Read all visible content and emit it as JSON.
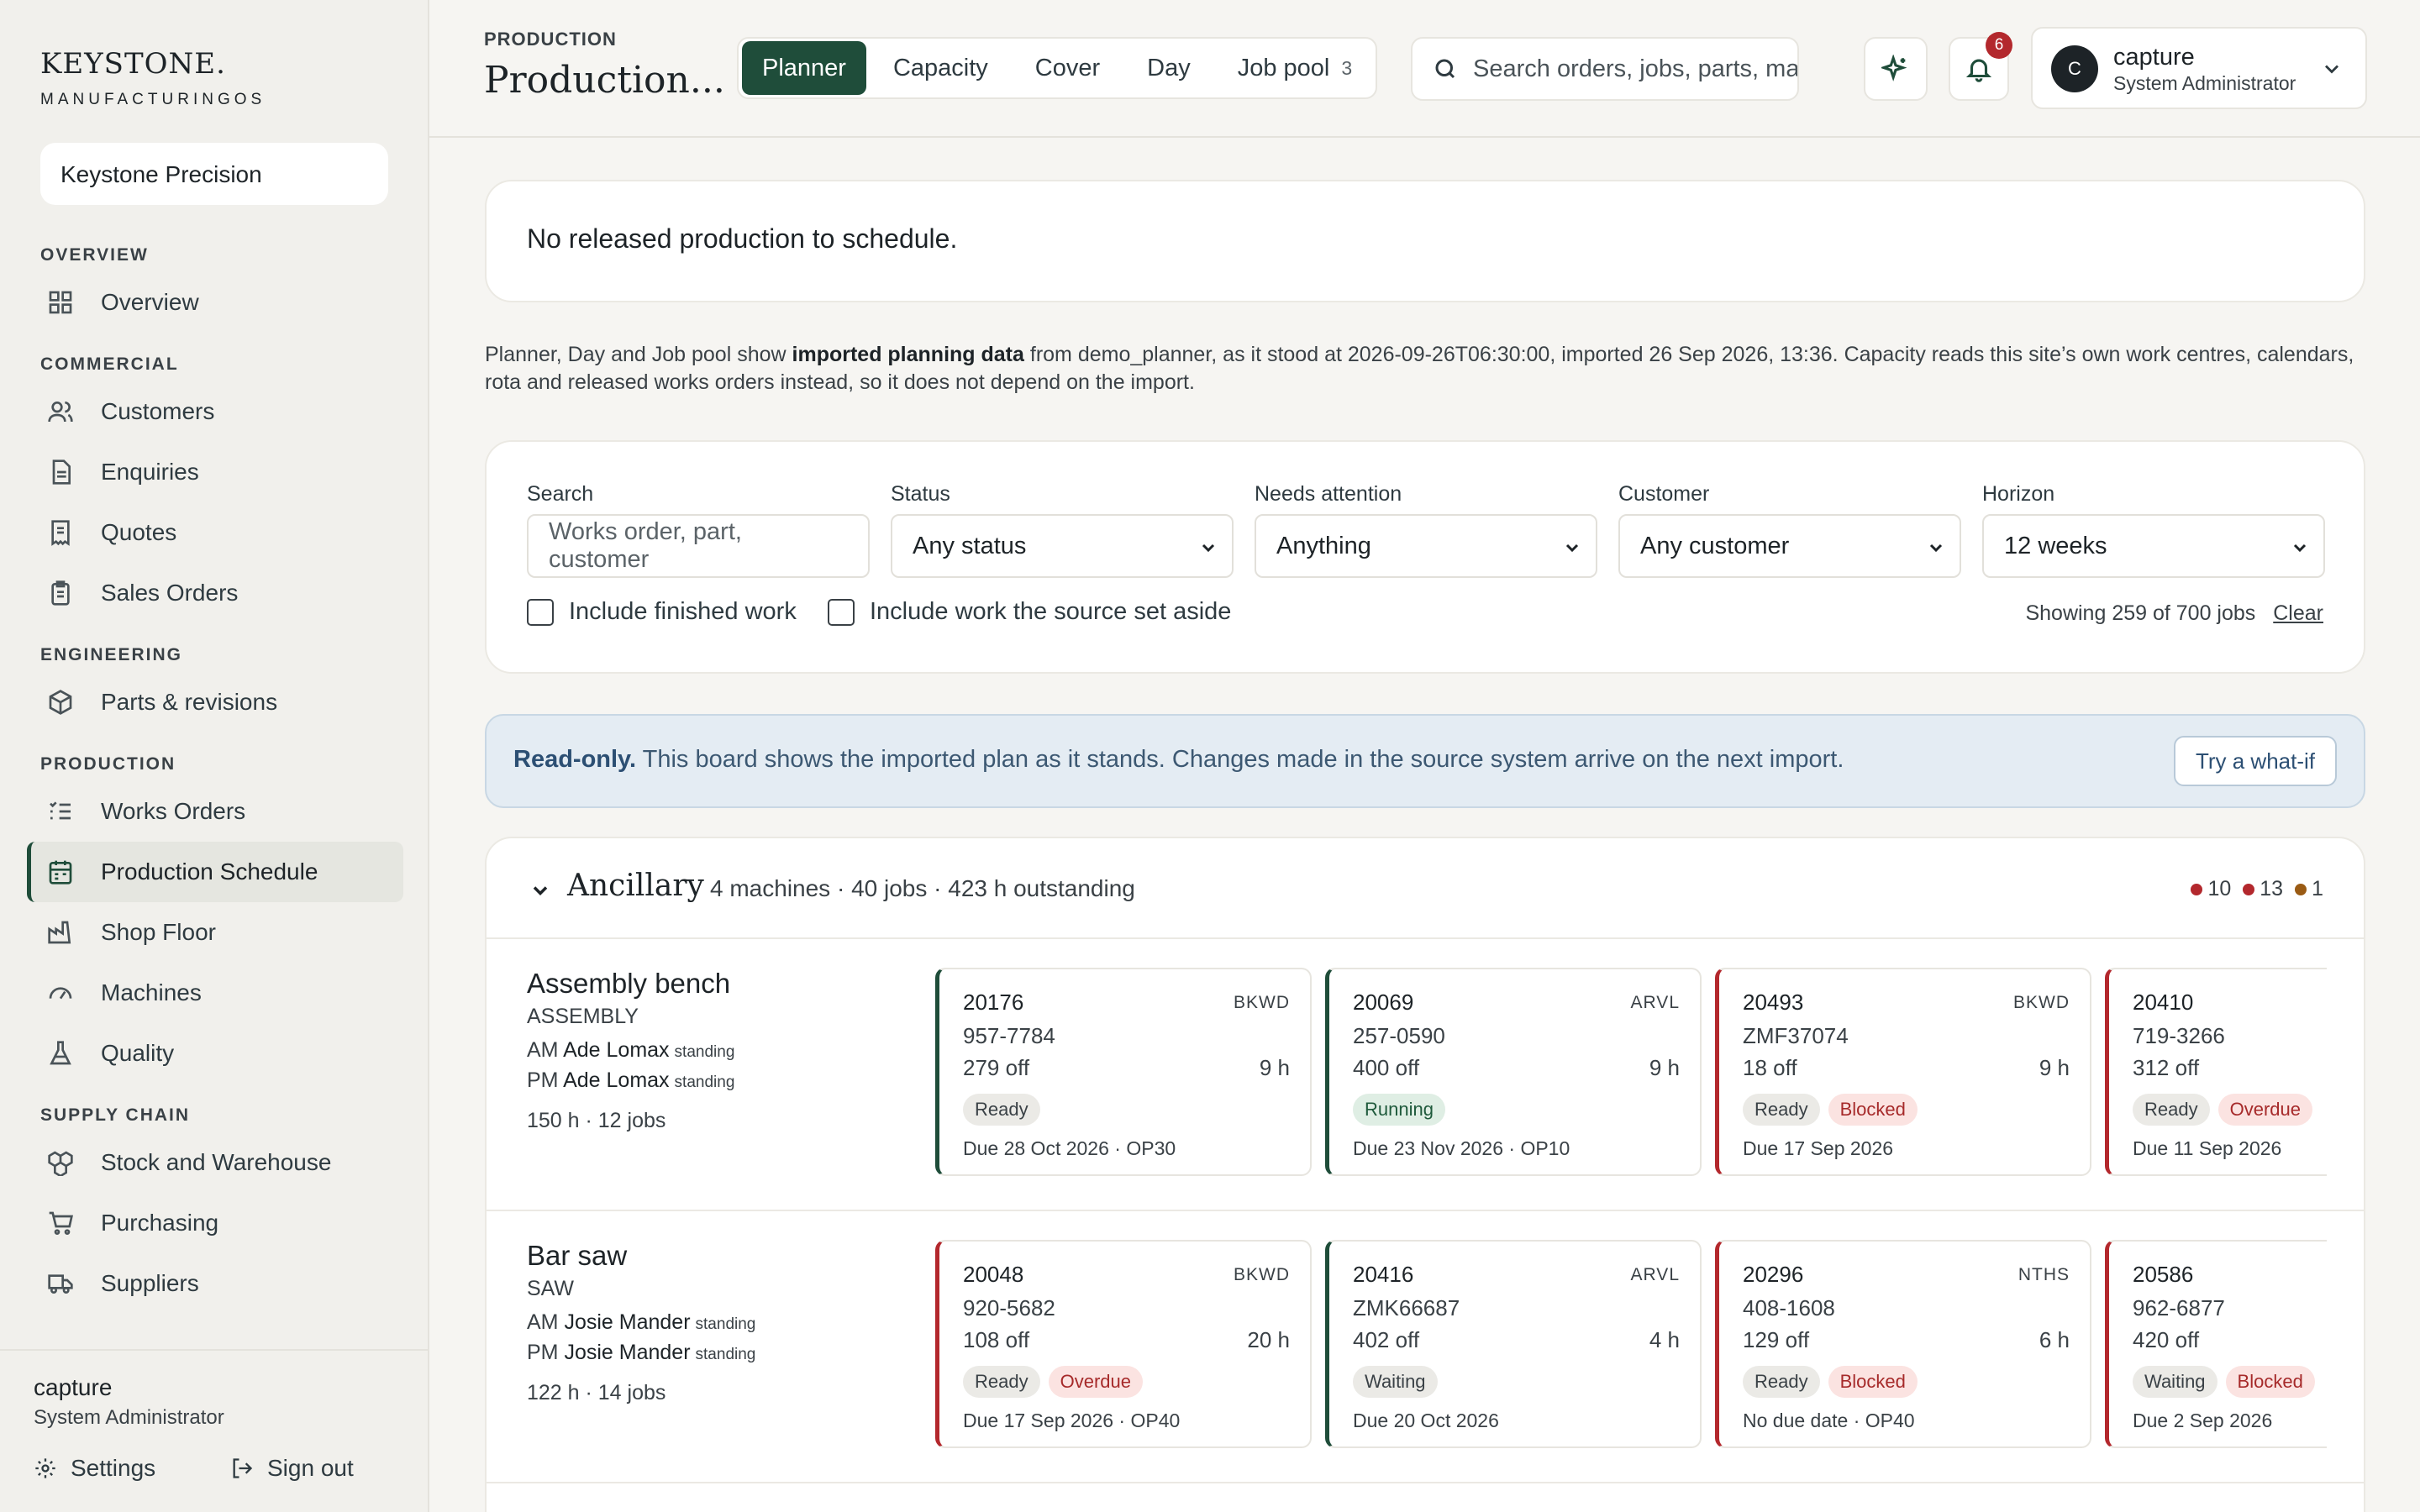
{
  "brand": {
    "name": "KEYSTONE.",
    "sub": "MANUFACTURINGOS"
  },
  "site": "Keystone Precision",
  "nav": {
    "overview_label": "OVERVIEW",
    "overview": "Overview",
    "commercial_label": "COMMERCIAL",
    "customers": "Customers",
    "enquiries": "Enquiries",
    "quotes": "Quotes",
    "sales_orders": "Sales Orders",
    "engineering_label": "ENGINEERING",
    "parts": "Parts & revisions",
    "production_label": "PRODUCTION",
    "works_orders": "Works Orders",
    "production_schedule": "Production Schedule",
    "shop_floor": "Shop Floor",
    "machines": "Machines",
    "quality": "Quality",
    "supply_label": "SUPPLY CHAIN",
    "stock": "Stock and Warehouse",
    "purchasing": "Purchasing",
    "suppliers": "Suppliers"
  },
  "sidebar_footer": {
    "user": "capture",
    "role": "System Administrator",
    "settings": "Settings",
    "signout": "Sign out"
  },
  "header": {
    "crumb": "PRODUCTION",
    "title": "Production...",
    "tabs": [
      {
        "label": "Planner"
      },
      {
        "label": "Capacity"
      },
      {
        "label": "Cover"
      },
      {
        "label": "Day"
      },
      {
        "label": "Job pool",
        "count": "3"
      }
    ],
    "search_placeholder": "Search orders, jobs, parts, machines",
    "notifications": "6",
    "user": {
      "initial": "C",
      "name": "capture",
      "role": "System Administrator"
    }
  },
  "empty_message": "No released production to schedule.",
  "note": {
    "p1": "Planner, Day and Job pool show ",
    "bold": "imported planning data",
    "p2": " from demo_planner, as it stood at 2026-09-26T06:30:00, imported 26 Sep 2026, 13:36. Capacity reads this site’s own work centres, calendars, rota and released works orders instead, so it does not depend on the import."
  },
  "filters": {
    "search_label": "Search",
    "search_placeholder": "Works order, part, customer",
    "status_label": "Status",
    "status_value": "Any status",
    "attention_label": "Needs attention",
    "attention_value": "Anything",
    "customer_label": "Customer",
    "customer_value": "Any customer",
    "horizon_label": "Horizon",
    "horizon_value": "12 weeks",
    "finished": "Include finished work",
    "setaside": "Include work the source set aside",
    "showing": "Showing 259 of 700 jobs",
    "clear": "Clear"
  },
  "readonly": {
    "bold": "Read-only.",
    "text": " This board shows the imported plan as it stands. Changes made in the source system arrive on the next import.",
    "button": "Try a what-if"
  },
  "group": {
    "title": "Ancillary",
    "meta": "4 machines · 40 jobs · 423 h outstanding",
    "counts": [
      {
        "value": "10",
        "color": "#b3282d"
      },
      {
        "value": "13",
        "color": "#b3282d"
      },
      {
        "value": "1",
        "color": "#9a5b14"
      }
    ]
  },
  "machines": [
    {
      "name": "Assembly bench",
      "type": "ASSEMBLY",
      "am": "Ade Lomax",
      "pm": "Ade Lomax",
      "shift_status": "standing",
      "load": "150 h · 12 jobs",
      "jobs": [
        {
          "id": "20176",
          "code": "BKWD",
          "part": "957-7784",
          "off": "279 off",
          "hours": "9 h",
          "tags": [
            {
              "t": "Ready",
              "k": "grey"
            }
          ],
          "due": "Due 28 Oct 2026 · OP30",
          "accent": "green"
        },
        {
          "id": "20069",
          "code": "ARVL",
          "part": "257-0590",
          "off": "400 off",
          "hours": "9 h",
          "tags": [
            {
              "t": "Running",
              "k": "green"
            }
          ],
          "due": "Due 23 Nov 2026 · OP10",
          "accent": "green"
        },
        {
          "id": "20493",
          "code": "BKWD",
          "part": "ZMF37074",
          "off": "18 off",
          "hours": "9 h",
          "tags": [
            {
              "t": "Ready",
              "k": "grey"
            },
            {
              "t": "Blocked",
              "k": "red"
            }
          ],
          "due": "Due 17 Sep 2026",
          "accent": "red"
        },
        {
          "id": "20410",
          "code": "",
          "part": "719-3266",
          "off": "312 off",
          "hours": "",
          "tags": [
            {
              "t": "Ready",
              "k": "grey"
            },
            {
              "t": "Overdue",
              "k": "red"
            }
          ],
          "due": "Due 11 Sep 2026",
          "accent": "red"
        }
      ]
    },
    {
      "name": "Bar saw",
      "type": "SAW",
      "am": "Josie Mander",
      "pm": "Josie Mander",
      "shift_status": "standing",
      "load": "122 h · 14 jobs",
      "jobs": [
        {
          "id": "20048",
          "code": "BKWD",
          "part": "920-5682",
          "off": "108 off",
          "hours": "20 h",
          "tags": [
            {
              "t": "Ready",
              "k": "grey"
            },
            {
              "t": "Overdue",
              "k": "red"
            }
          ],
          "due": "Due 17 Sep 2026 · OP40",
          "accent": "red"
        },
        {
          "id": "20416",
          "code": "ARVL",
          "part": "ZMK66687",
          "off": "402 off",
          "hours": "4 h",
          "tags": [
            {
              "t": "Waiting",
              "k": "grey"
            }
          ],
          "due": "Due 20 Oct 2026",
          "accent": "green"
        },
        {
          "id": "20296",
          "code": "NTHS",
          "part": "408-1608",
          "off": "129 off",
          "hours": "6 h",
          "tags": [
            {
              "t": "Ready",
              "k": "grey"
            },
            {
              "t": "Blocked",
              "k": "red"
            }
          ],
          "due": "No due date · OP40",
          "accent": "red"
        },
        {
          "id": "20586",
          "code": "",
          "part": "962-6877",
          "off": "420 off",
          "hours": "",
          "tags": [
            {
              "t": "Waiting",
              "k": "grey"
            },
            {
              "t": "Blocked",
              "k": "red"
            }
          ],
          "due": "Due 2 Sep 2026",
          "accent": "red"
        }
      ]
    }
  ]
}
